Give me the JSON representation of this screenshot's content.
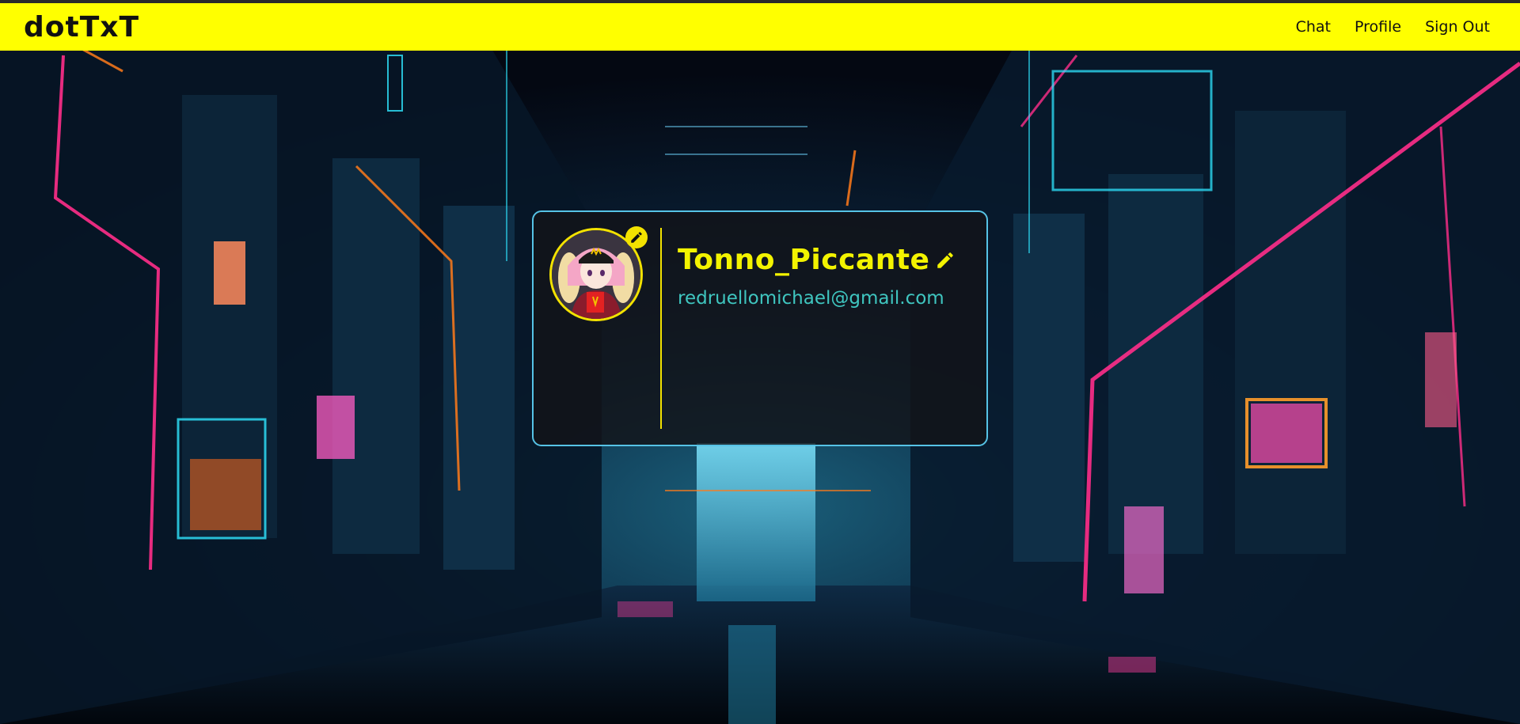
{
  "app": {
    "logo": "dotTxT"
  },
  "nav": {
    "items": [
      {
        "label": "Chat"
      },
      {
        "label": "Profile"
      },
      {
        "label": "Sign Out"
      }
    ]
  },
  "profile": {
    "username": "Tonno_Piccante",
    "email": "redruellomichael@gmail.com",
    "avatar_icon": "anime-girl-avatar",
    "edit_avatar_icon": "pencil-icon",
    "edit_name_icon": "pencil-icon"
  },
  "colors": {
    "topbar": "#ffff00",
    "accent_yellow": "#f3f300",
    "card_border": "#56c3e6",
    "email": "#3fc6c0",
    "neon_pink": "#ff2e8a",
    "neon_cyan": "#2fe6ff",
    "neon_orange": "#ff7a1a"
  }
}
